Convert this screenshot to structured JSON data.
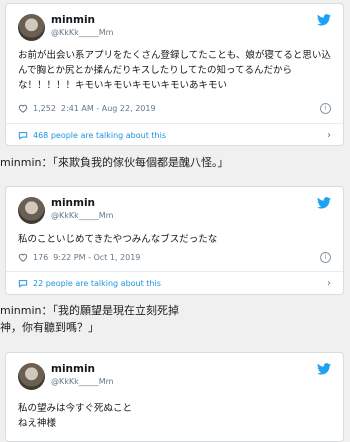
{
  "tweets": [
    {
      "name": "minmin",
      "handle": "@KkKk_____Mm",
      "text": "お前が出会い系アプリをたくさん登録してたことも、娘が寝てると思い込んで胸とか尻とか揉んだりキスしたりしてたの知ってるんだからな！！！！！キモいキモいキモいキモいあキモい",
      "likes": "1,252",
      "timestamp": "2:41 AM - Aug 22, 2019",
      "talking": "468 people are talking about this"
    },
    {
      "name": "minmin",
      "handle": "@KkKk_____Mm",
      "text": "私のこといじめてきたやつみんなブスだったな",
      "likes": "176",
      "timestamp": "9:22 PM - Oct 1, 2019",
      "talking": "22 people are talking about this"
    },
    {
      "name": "minmin",
      "handle": "@KkKk_____Mm",
      "text": "私の望みは今すぐ死ぬこと\nねえ神様"
    }
  ],
  "captions": [
    "minmin：「來欺負我的傢伙每個都是醜八怪。」",
    "minmin：「我的願望是現在立刻死掉\n神，你有聽到嗎？」"
  ],
  "colors": {
    "twitter_blue": "#1da1f2",
    "link_blue": "#1b95e0",
    "heart_red": "#e0245e"
  }
}
